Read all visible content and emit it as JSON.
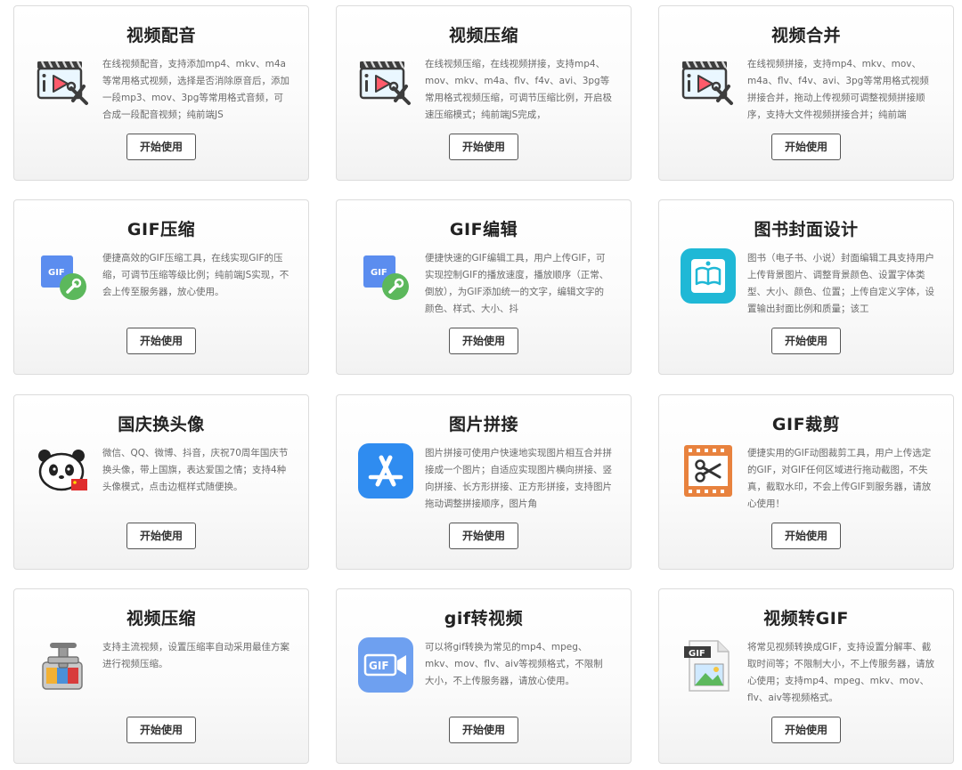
{
  "tools": [
    {
      "title": "视频配音",
      "icon": "video-edit-icon",
      "description": "在线视频配音，支持添加mp4、mkv、m4a等常用格式视频，选择是否消除原音后，添加一段mp3、mov、3pg等常用格式音频，可合成一段配音视频；纯前端JS",
      "button": "开始使用"
    },
    {
      "title": "视频压缩",
      "icon": "video-edit-icon",
      "description": "在线视频压缩，在线视频拼接，支持mp4、mov、mkv、m4a、flv、f4v、avi、3pg等常用格式视频压缩，可调节压缩比例，开启极速压缩模式；纯前端JS完成，",
      "button": "开始使用"
    },
    {
      "title": "视频合并",
      "icon": "video-edit-icon",
      "description": "在线视频拼接，支持mp4、mkv、mov、m4a、flv、f4v、avi、3pg等常用格式视频拼接合并，拖动上传视频可调整视频拼接顺序，支持大文件视频拼接合并；纯前端",
      "button": "开始使用"
    },
    {
      "title": "GIF压缩",
      "icon": "gif-wrench-icon",
      "description": "便捷高效的GIF压缩工具，在线实现GIF的压缩，可调节压缩等级比例；纯前端JS实现，不会上传至服务器，放心使用。",
      "button": "开始使用"
    },
    {
      "title": "GIF编辑",
      "icon": "gif-wrench-icon",
      "description": "便捷快速的GIF编辑工具，用户上传GIF，可实现控制GIF的播放速度，播放顺序（正常、倒放），为GIF添加统一的文字，编辑文字的颜色、样式、大小、抖",
      "button": "开始使用"
    },
    {
      "title": "图书封面设计",
      "icon": "book-cover-icon",
      "description": "图书（电子书、小说）封面编辑工具支持用户上传背景图片、调整背景颜色、设置字体类型、大小、颜色、位置；上传自定义字体，设置输出封面比例和质量；该工",
      "button": "开始使用"
    },
    {
      "title": "国庆换头像",
      "icon": "panda-flag-icon",
      "description": "微信、QQ、微博、抖音，庆祝70周年国庆节换头像，带上国旗，表达爱国之情；支持4种头像模式，点击边框样式随便换。",
      "button": "开始使用"
    },
    {
      "title": "图片拼接",
      "icon": "app-store-icon",
      "description": "图片拼接可使用户快速地实现图片相互合并拼接成一个图片；自适应实现图片横向拼接、竖向拼接、长方形拼接、正方形拼接，支持图片拖动调整拼接顺序，图片角",
      "button": "开始使用"
    },
    {
      "title": "GIF裁剪",
      "icon": "film-scissors-icon",
      "description": "便捷实用的GIF动图裁剪工具，用户上传选定的GIF，对GIF任何区域进行拖动截图，不失真，截取水印，不会上传GIF到服务器，请放心使用！",
      "button": "开始使用"
    },
    {
      "title": "视频压缩",
      "icon": "compressor-vise-icon",
      "description": "支持主流视频，设置压缩率自动采用最佳方案进行视频压缩。",
      "button": "开始使用"
    },
    {
      "title": "gif转视频",
      "icon": "gif-to-video-icon",
      "description": "可以将gif转换为常见的mp4、mpeg、mkv、mov、flv、aiv等视频格式，不限制大小，不上传服务器，请放心使用。",
      "button": "开始使用"
    },
    {
      "title": "视频转GIF",
      "icon": "gif-file-icon",
      "description": "将常见视频转换成GIF，支持设置分解率、截取时间等；不限制大小，不上传服务器，请放心使用；支持mp4、mpeg、mkv、mov、flv、aiv等视频格式。",
      "button": "开始使用"
    }
  ]
}
